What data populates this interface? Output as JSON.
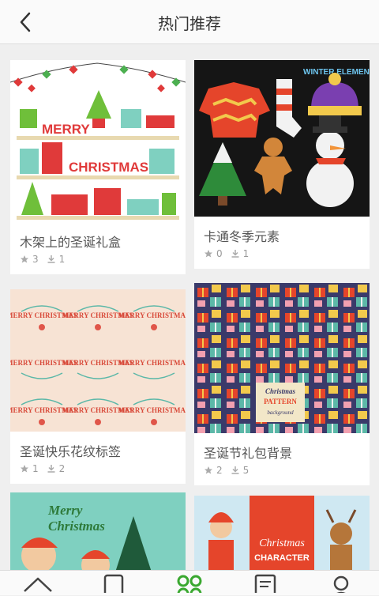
{
  "header": {
    "title": "热门推荐"
  },
  "cards": [
    {
      "name": "木架上的圣诞礼盒",
      "stars": "3",
      "downloads": "1",
      "art_text": [
        "MERRY",
        "CHRISTMAS"
      ]
    },
    {
      "name": "卡通冬季元素",
      "stars": "0",
      "downloads": "1",
      "art_text": [
        "WINTER ELEMENTS"
      ]
    },
    {
      "name": "圣诞快乐花纹标签",
      "stars": "1",
      "downloads": "2",
      "art_text": [
        "MERRY CHRISTMAS"
      ]
    },
    {
      "name": "圣诞节礼包背景",
      "stars": "2",
      "downloads": "5",
      "art_text": [
        "Christmas",
        "PATTERN",
        "background"
      ]
    },
    {
      "name": "",
      "stars": "",
      "downloads": "",
      "art_text": [
        "Merry",
        "Christmas"
      ]
    },
    {
      "name": "",
      "stars": "",
      "downloads": "",
      "art_text": [
        "Christmas",
        "CHARACTER"
      ]
    }
  ],
  "colors": {
    "accent": "#3aa830",
    "text": "#555555",
    "muted": "#999999"
  },
  "tabbar": {
    "items": [
      "home-icon",
      "phone-icon",
      "apps-icon",
      "list-icon",
      "user-icon"
    ],
    "active": 2
  }
}
